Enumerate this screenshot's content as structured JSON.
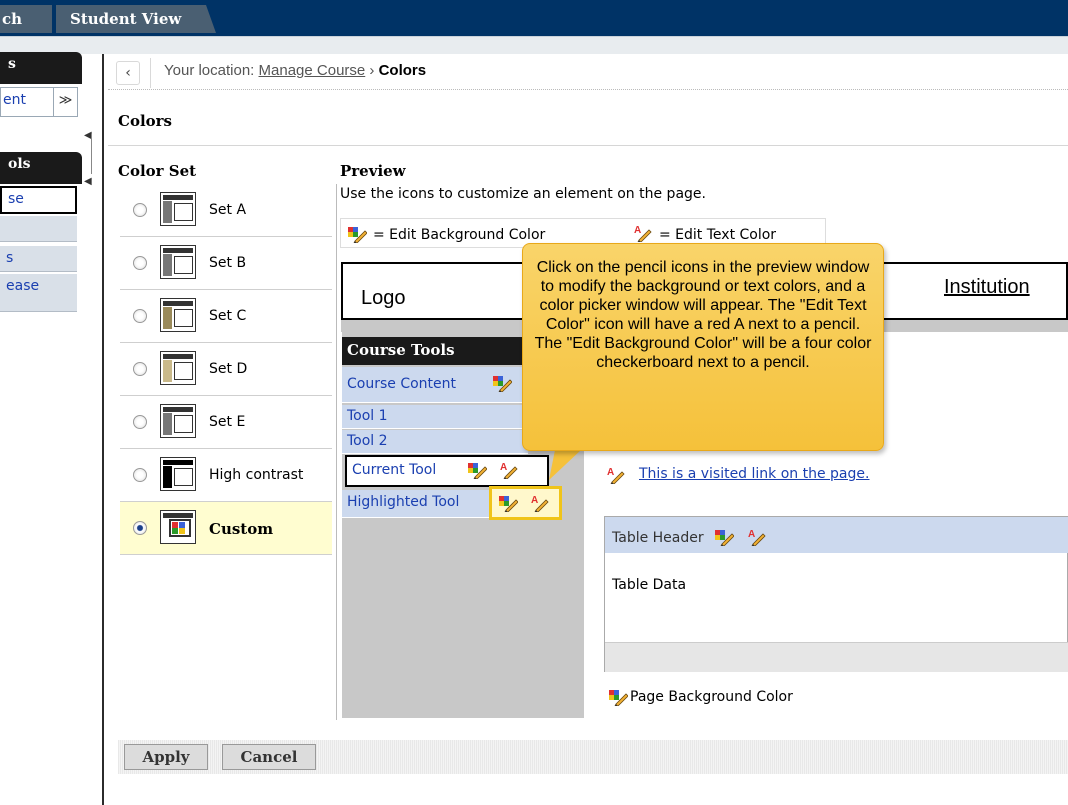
{
  "topnav": {
    "tab_search": "ch",
    "tab_student_view": "Student View"
  },
  "sidebar": {
    "header_1": "s",
    "content_label": "ent",
    "header_2": "ols",
    "item_course": "se",
    "item_s": "s",
    "item_ease": "ease"
  },
  "breadcrumb": {
    "prefix": "Your location: ",
    "link": "Manage Course",
    "separator": " › ",
    "current": "Colors"
  },
  "page_title": "Colors",
  "color_set": {
    "heading": "Color Set",
    "options": [
      {
        "label": "Set A"
      },
      {
        "label": "Set B"
      },
      {
        "label": "Set C"
      },
      {
        "label": "Set D"
      },
      {
        "label": "Set E"
      },
      {
        "label": "High contrast"
      },
      {
        "label": "Custom"
      }
    ],
    "selected": "Custom"
  },
  "preview": {
    "heading": "Preview",
    "description": "Use the icons to customize an element on the page.",
    "legend_bg": "= Edit Background Color",
    "legend_text": "= Edit Text Color",
    "logo": "Logo",
    "institution": "Institution",
    "course_tools_header": "Course Tools",
    "tools": {
      "course_content": "Course Content",
      "tool_1": "Tool 1",
      "tool_2": "Tool 2",
      "current_tool": "Current Tool",
      "highlighted_tool": "Highlighted Tool"
    },
    "visited_link": "This is a visited link on the page.",
    "table_header": "Table Header",
    "table_data": "Table Data",
    "page_background": "Page Background Color"
  },
  "tooltip": "Click on the pencil icons in the preview window to modify the background or text colors, and a color picker window will appear. The \"Edit Text Color\" icon will have a red A next to a pencil. The \"Edit Background Color\" will be a four color checkerboard next to a pencil.",
  "buttons": {
    "apply": "Apply",
    "cancel": "Cancel"
  },
  "colors": {
    "top_bar": "#003366",
    "tooltip": "#f5c13a",
    "highlight": "#f0c419",
    "link": "#1a3fb0",
    "tool_row": "#ccd9ee"
  }
}
